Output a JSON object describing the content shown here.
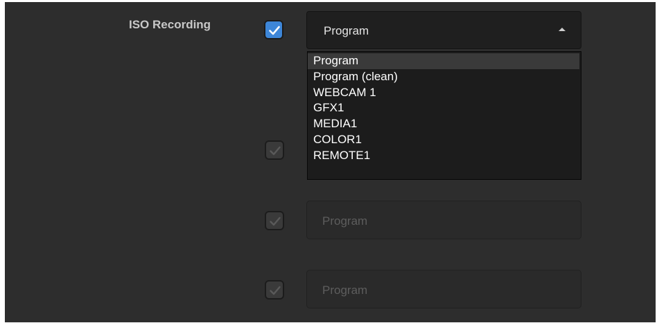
{
  "iso": {
    "label": "ISO Recording",
    "checked": true
  },
  "main_select": {
    "value": "Program",
    "expanded": true,
    "options": [
      "Program",
      "Program (clean)",
      "WEBCAM 1",
      "GFX1",
      "MEDIA1",
      "COLOR1",
      "REMOTE1"
    ],
    "highlighted_index": 0
  },
  "rows": [
    {
      "checked": true,
      "enabled": false,
      "value": ""
    },
    {
      "checked": true,
      "enabled": false,
      "value": "Program"
    },
    {
      "checked": true,
      "enabled": false,
      "value": "Program"
    }
  ],
  "colors": {
    "panel_bg": "#2d2d2d",
    "accent": "#3d86d8",
    "dropdown_bg": "#1c1c1c",
    "highlight": "#3a3a3a"
  }
}
